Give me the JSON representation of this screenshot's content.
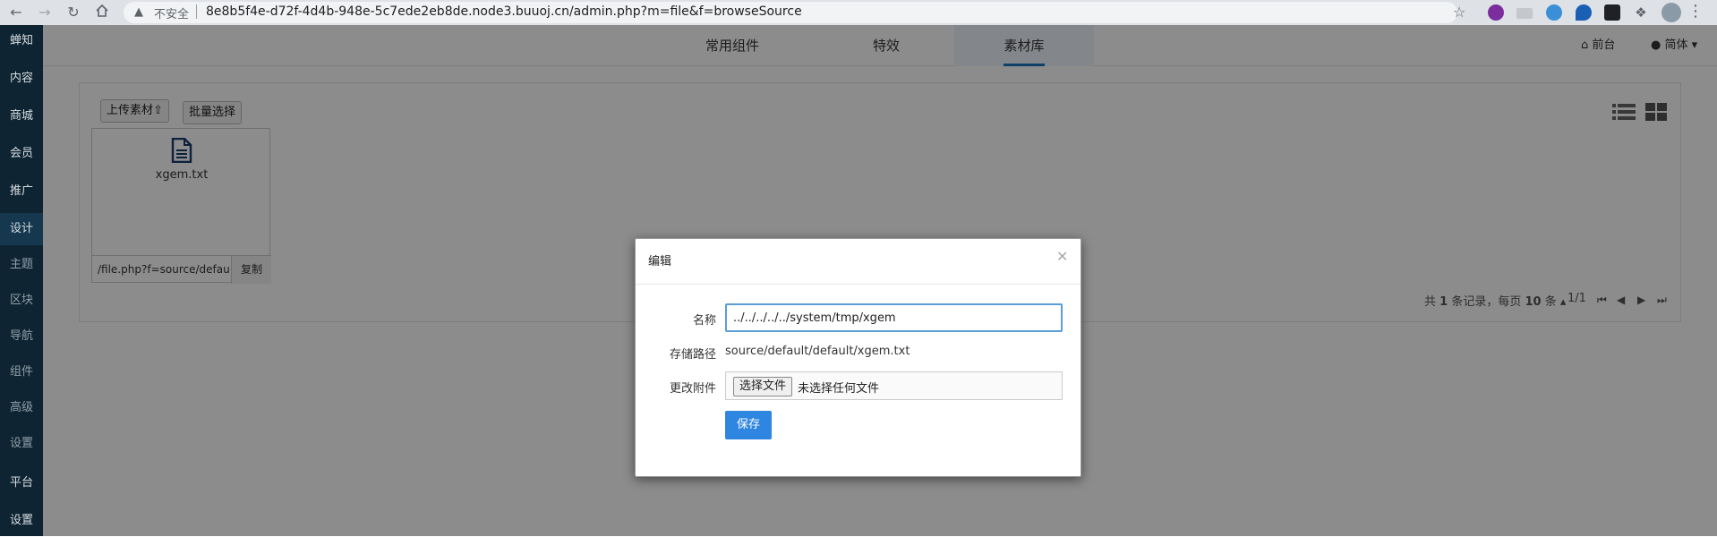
{
  "browser": {
    "insecure_label": "不安全",
    "url": "8e8b5f4e-d72f-4d4b-948e-5c7ede2eb8de.node3.buuoj.cn/admin.php?m=file&f=browseSource"
  },
  "sidebar": {
    "items": [
      {
        "label": "蝉知"
      },
      {
        "label": "内容"
      },
      {
        "label": "商城"
      },
      {
        "label": "会员"
      },
      {
        "label": "推广"
      },
      {
        "label": "设计"
      },
      {
        "label": "主题"
      },
      {
        "label": "区块"
      },
      {
        "label": "导航"
      },
      {
        "label": "组件"
      },
      {
        "label": "高级"
      },
      {
        "label": "设置"
      },
      {
        "label": "平台"
      },
      {
        "label": "设置"
      }
    ]
  },
  "topnav": {
    "tabs": [
      {
        "label": "常用组件"
      },
      {
        "label": "特效"
      },
      {
        "label": "素材库"
      }
    ],
    "front_label": "前台",
    "lang_label": "简体"
  },
  "toolbar": {
    "upload_label": "上传素材",
    "batch_label": "批量选择"
  },
  "file_card": {
    "filename": "xgem.txt",
    "path": "/file.php?f=source/defau",
    "copy_label": "复制"
  },
  "pager": {
    "text_prefix": "共",
    "total": "1",
    "text_records": "条记录，每页",
    "per_page": "10",
    "text_unit": "条",
    "page": "1/1"
  },
  "modal": {
    "title": "编辑",
    "name_label": "名称",
    "name_value": "../../../../../system/tmp/xgem",
    "path_label": "存储路径",
    "path_value": "source/default/default/xgem.txt",
    "attach_label": "更改附件",
    "choose_file_label": "选择文件",
    "no_file_label": "未选择任何文件",
    "save_label": "保存"
  },
  "colors": {
    "sidebar_bg": "#0e2432",
    "accent": "#2f86e0",
    "input_focus": "#5b9dd9"
  }
}
